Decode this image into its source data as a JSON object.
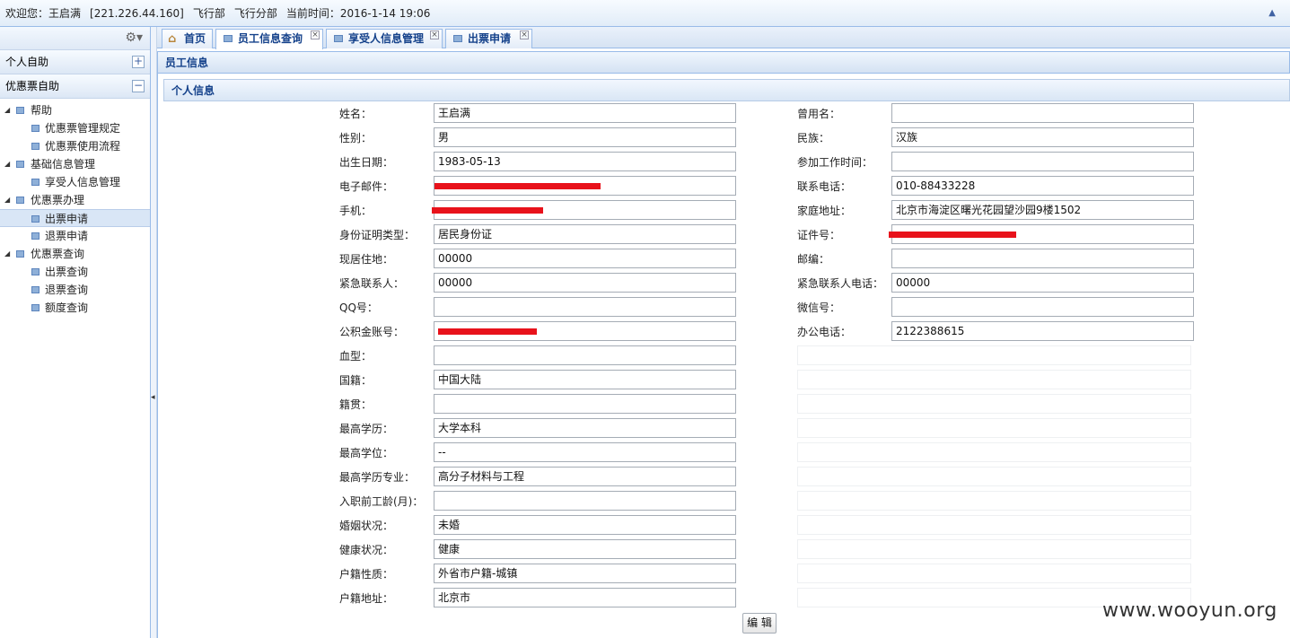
{
  "topbar": {
    "welcome": "欢迎您：王启满",
    "ip": "[221.226.44.160]",
    "dept": "飞行部",
    "branch": "飞行分部",
    "time": "当前时间：2016-1-14 19:06"
  },
  "sidebar": {
    "section1": "个人自助",
    "section2": "优惠票自助",
    "section1_toggle": "+",
    "section2_toggle": "−",
    "tree": [
      {
        "label": "帮助",
        "level": 0
      },
      {
        "label": "优惠票管理规定",
        "level": 1
      },
      {
        "label": "优惠票使用流程",
        "level": 1
      },
      {
        "label": "基础信息管理",
        "level": 0
      },
      {
        "label": "享受人信息管理",
        "level": 1
      },
      {
        "label": "优惠票办理",
        "level": 0
      },
      {
        "label": "出票申请",
        "level": 1,
        "selected": true
      },
      {
        "label": "退票申请",
        "level": 1
      },
      {
        "label": "优惠票查询",
        "level": 0
      },
      {
        "label": "出票查询",
        "level": 1
      },
      {
        "label": "退票查询",
        "level": 1
      },
      {
        "label": "额度查询",
        "level": 1
      }
    ]
  },
  "tabs": [
    "首页",
    "员工信息查询",
    "享受人信息管理",
    "出票申请"
  ],
  "tab_close": "×",
  "panel_title": "员工信息",
  "fieldset_title": "个人信息",
  "left_fields": [
    {
      "label": "姓名：",
      "value": "王启满"
    },
    {
      "label": "性别：",
      "value": "男"
    },
    {
      "label": "出生日期：",
      "value": "1983-05-13"
    },
    {
      "label": "电子邮件：",
      "value": "",
      "redacted": true
    },
    {
      "label": "手机：",
      "value": "",
      "redacted": true
    },
    {
      "label": "身份证明类型：",
      "value": "居民身份证"
    },
    {
      "label": "现居住地：",
      "value": "00000"
    },
    {
      "label": "紧急联系人：",
      "value": "00000"
    },
    {
      "label": "QQ号：",
      "value": ""
    },
    {
      "label": "公积金账号：",
      "value": "",
      "redacted": true
    },
    {
      "label": "血型：",
      "value": ""
    },
    {
      "label": "国籍：",
      "value": "中国大陆"
    },
    {
      "label": "籍贯：",
      "value": ""
    },
    {
      "label": "最高学历：",
      "value": "大学本科"
    },
    {
      "label": "最高学位：",
      "value": "--"
    },
    {
      "label": "最高学历专业：",
      "value": "高分子材料与工程"
    },
    {
      "label": "入职前工龄(月)：",
      "value": ""
    },
    {
      "label": "婚姻状况：",
      "value": "未婚"
    },
    {
      "label": "健康状况：",
      "value": "健康"
    },
    {
      "label": "户籍性质：",
      "value": "外省市户籍-城镇"
    },
    {
      "label": "户籍地址：",
      "value": "北京市"
    }
  ],
  "right_fields": [
    {
      "label": "曾用名：",
      "value": ""
    },
    {
      "label": "民族：",
      "value": "汉族"
    },
    {
      "label": "参加工作时间：",
      "value": ""
    },
    {
      "label": "联系电话：",
      "value": "010-88433228"
    },
    {
      "label": "家庭地址：",
      "value": "北京市海淀区曙光花园望沙园9楼1502"
    },
    {
      "label": "证件号：",
      "value": "",
      "redacted": true
    },
    {
      "label": "邮编：",
      "value": ""
    },
    {
      "label": "紧急联系人电话：",
      "value": "00000"
    },
    {
      "label": "微信号：",
      "value": ""
    },
    {
      "label": "办公电话：",
      "value": "2122388615"
    }
  ],
  "edit_button": "编 辑",
  "watermark": "www.wooyun.org",
  "colors": {
    "redact": "#e8121b",
    "header_text": "#15428b",
    "border": "#99bbe8"
  }
}
